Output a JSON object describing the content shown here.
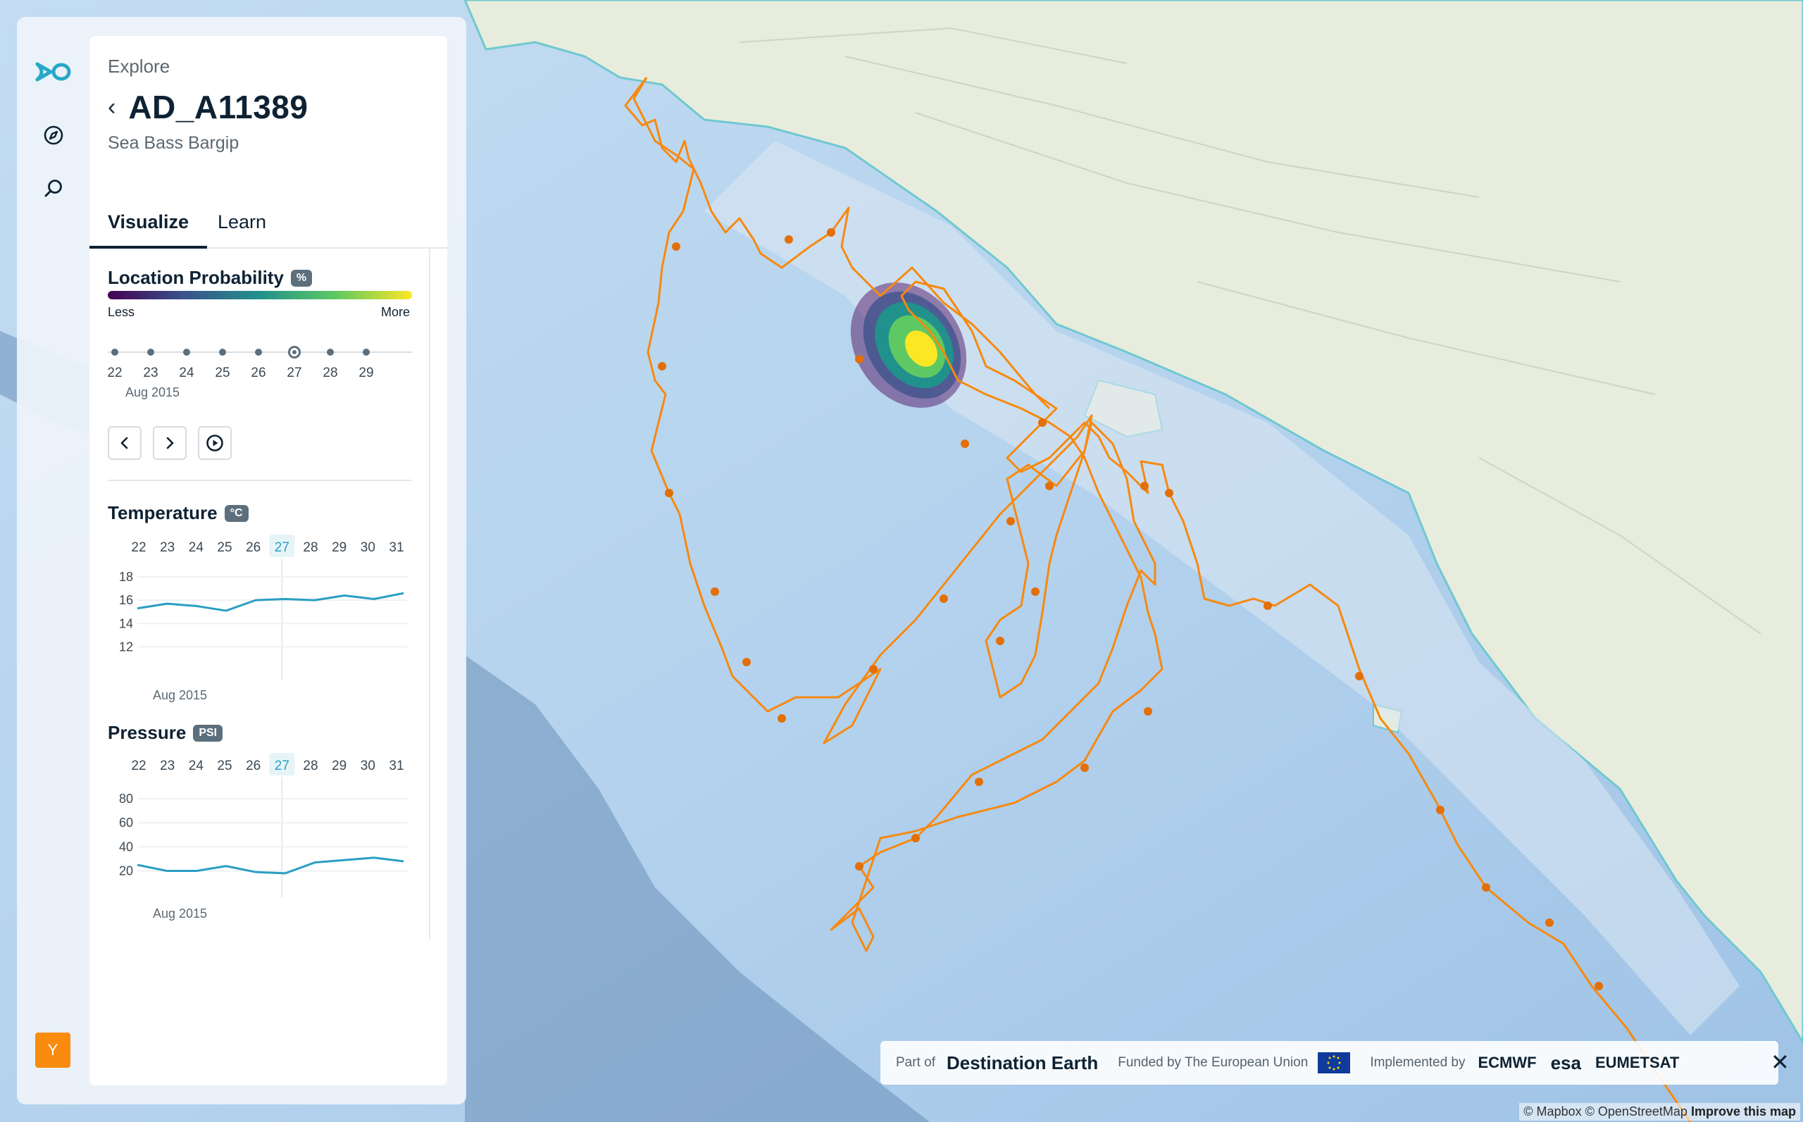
{
  "breadcrumb": "Explore",
  "tag": {
    "title": "AD_A11389",
    "subtitle": "Sea Bass Bargip"
  },
  "tabs": [
    {
      "label": "Visualize",
      "active": true
    },
    {
      "label": "Learn",
      "active": false
    }
  ],
  "location_probability": {
    "title": "Location Probability",
    "unit": "%",
    "legend_low": "Less",
    "legend_high": "More",
    "days": [
      "22",
      "23",
      "24",
      "25",
      "26",
      "27",
      "28",
      "29"
    ],
    "selected_day": "27",
    "month_label": "Aug 2015",
    "colors": [
      "#440154",
      "#3b528b",
      "#21918c",
      "#5ec962",
      "#fde725"
    ]
  },
  "temperature": {
    "title": "Temperature",
    "unit": "°C",
    "month_label": "Aug 2015"
  },
  "pressure": {
    "title": "Pressure",
    "unit": "PSI",
    "month_label": "Aug 2015"
  },
  "chart_data": [
    {
      "type": "line",
      "title": "Temperature",
      "x": [
        "22",
        "23",
        "24",
        "25",
        "26",
        "27",
        "28",
        "29",
        "30",
        "31"
      ],
      "highlight": "27",
      "ylim": [
        11,
        18
      ],
      "yticks": [
        18,
        16,
        14,
        12
      ],
      "series": [
        {
          "values": [
            15.3,
            15.7,
            15.5,
            15.1,
            16.0,
            16.1,
            16.0,
            16.4,
            16.1,
            16.6
          ],
          "color": "#2a9ec2"
        }
      ],
      "xlabel": "Aug 2015"
    },
    {
      "type": "line",
      "title": "Pressure",
      "x": [
        "22",
        "23",
        "24",
        "25",
        "26",
        "27",
        "28",
        "29",
        "30",
        "31"
      ],
      "highlight": "27",
      "ylim": [
        15,
        83
      ],
      "yticks": [
        80,
        60,
        40,
        20
      ],
      "series": [
        {
          "values": [
            25,
            20,
            20,
            24,
            19,
            18,
            27,
            29,
            31,
            28
          ],
          "color": "#2a9ec2"
        }
      ],
      "xlabel": "Aug 2015"
    }
  ],
  "footer": {
    "part_of": "Part of",
    "destination": "Destination Earth",
    "funded": "Funded by The European Union",
    "implemented": "Implemented by",
    "partners": [
      "ECMWF",
      "esa",
      "EUMETSAT"
    ]
  },
  "user_initial": "Y",
  "map_attribution": {
    "osm": "© Mapbox © OpenStreetMap",
    "improve": "Improve this map"
  },
  "colors": {
    "accent": "#2a9ec2",
    "track": "#f7890f",
    "brand": "#26a9c6",
    "avatar": "#f98c0f"
  }
}
